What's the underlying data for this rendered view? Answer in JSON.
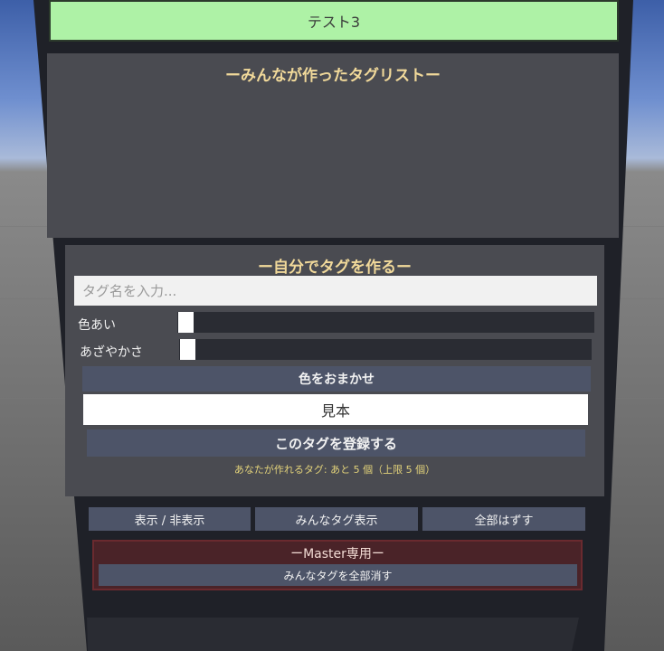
{
  "tag_list_item": {
    "label": "テスト3"
  },
  "shared_tags": {
    "heading": "ーみんなが作ったタグリストー"
  },
  "create": {
    "heading": "ー自分でタグを作るー",
    "name_placeholder": "タグ名を入力...",
    "hue_label": "色あい",
    "hue_value": 0.0,
    "saturation_label": "あざやかさ",
    "saturation_value": 0.0,
    "random_color_label": "色をおまかせ",
    "sample_label": "見本",
    "register_label": "このタグを登録する",
    "remaining_note": "あなたが作れるタグ: あと 5 個（上限 5 個）"
  },
  "toolbar": {
    "toggle_label": "表示 / 非表示",
    "show_all_label": "みんなタグ表示",
    "remove_all_label": "全部はずす"
  },
  "master": {
    "title": "ーMaster専用ー",
    "delete_all_label": "みんなタグを全部消す"
  },
  "colors": {
    "tag_green": "#aef2a6",
    "heading_gold": "#f1d99a",
    "button": "#4d5468",
    "master_bg": "#4a2328"
  }
}
